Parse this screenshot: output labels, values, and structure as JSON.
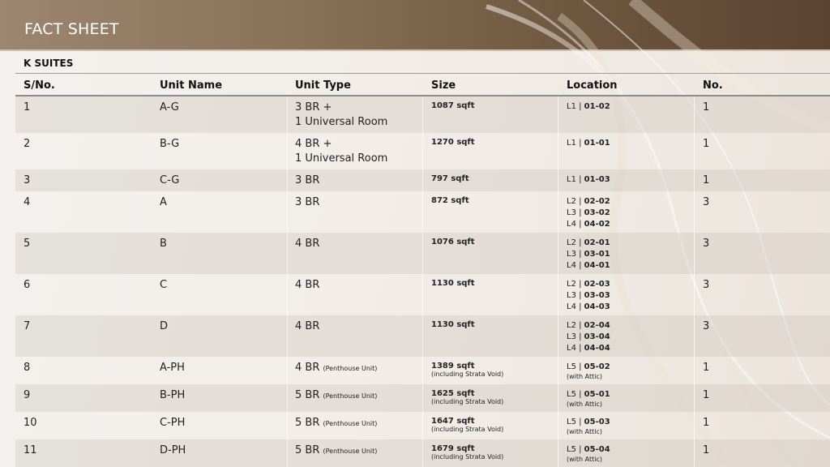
{
  "header": {
    "title": "FACT SHEET"
  },
  "section": {
    "title": "K SUITES"
  },
  "columns": [
    "S/No.",
    "Unit Name",
    "Unit Type",
    "Size",
    "Location",
    "No."
  ],
  "rows": [
    {
      "sno": "1",
      "name": "A-G",
      "type": "3 BR +",
      "type2": "1 Universal Room",
      "type_note": "",
      "size": "1087 sqft",
      "size_note": "",
      "loc": [
        [
          "L1",
          "01-02"
        ]
      ],
      "loc_note": "",
      "no": "1"
    },
    {
      "sno": "2",
      "name": "B-G",
      "type": "4 BR +",
      "type2": "1 Universal Room",
      "type_note": "",
      "size": "1270 sqft",
      "size_note": "",
      "loc": [
        [
          "L1",
          "01-01"
        ]
      ],
      "loc_note": "",
      "no": "1"
    },
    {
      "sno": "3",
      "name": "C-G",
      "type": "3 BR",
      "type2": "",
      "type_note": "",
      "size": "797 sqft",
      "size_note": "",
      "loc": [
        [
          "L1",
          "01-03"
        ]
      ],
      "loc_note": "",
      "no": "1"
    },
    {
      "sno": "4",
      "name": "A",
      "type": "3 BR",
      "type2": "",
      "type_note": "",
      "size": "872 sqft",
      "size_note": "",
      "loc": [
        [
          "L2",
          "02-02"
        ],
        [
          "L3",
          "03-02"
        ],
        [
          "L4",
          "04-02"
        ]
      ],
      "loc_note": "",
      "no": "3"
    },
    {
      "sno": "5",
      "name": "B",
      "type": "4 BR",
      "type2": "",
      "type_note": "",
      "size": "1076 sqft",
      "size_note": "",
      "loc": [
        [
          "L2",
          "02-01"
        ],
        [
          "L3",
          "03-01"
        ],
        [
          "L4",
          "04-01"
        ]
      ],
      "loc_note": "",
      "no": "3"
    },
    {
      "sno": "6",
      "name": "C",
      "type": "4 BR",
      "type2": "",
      "type_note": "",
      "size": "1130 sqft",
      "size_note": "",
      "loc": [
        [
          "L2",
          "02-03"
        ],
        [
          "L3",
          "03-03"
        ],
        [
          "L4",
          "04-03"
        ]
      ],
      "loc_note": "",
      "no": "3"
    },
    {
      "sno": "7",
      "name": "D",
      "type": "4 BR",
      "type2": "",
      "type_note": "",
      "size": "1130 sqft",
      "size_note": "",
      "loc": [
        [
          "L2",
          "02-04"
        ],
        [
          "L3",
          "03-04"
        ],
        [
          "L4",
          "04-04"
        ]
      ],
      "loc_note": "",
      "no": "3"
    },
    {
      "sno": "8",
      "name": "A-PH",
      "type": "4 BR",
      "type2": "",
      "type_note": "(Penthouse Unit)",
      "size": "1389 sqft",
      "size_note": "(including Strata Void)",
      "loc": [
        [
          "L5",
          "05-02"
        ]
      ],
      "loc_note": "(with Attic)",
      "no": "1"
    },
    {
      "sno": "9",
      "name": "B-PH",
      "type": "5 BR",
      "type2": "",
      "type_note": "(Penthouse Unit)",
      "size": "1625 sqft",
      "size_note": "(including Strata Void)",
      "loc": [
        [
          "L5",
          "05-01"
        ]
      ],
      "loc_note": "(with Attic)",
      "no": "1"
    },
    {
      "sno": "10",
      "name": "C-PH",
      "type": "5 BR",
      "type2": "",
      "type_note": "(Penthouse Unit)",
      "size": "1647 sqft",
      "size_note": "(including Strata Void)",
      "loc": [
        [
          "L5",
          "05-03"
        ]
      ],
      "loc_note": "(with Attic)",
      "no": "1"
    },
    {
      "sno": "11",
      "name": "D-PH",
      "type": "5 BR",
      "type2": "",
      "type_note": "(Penthouse Unit)",
      "size": "1679 sqft",
      "size_note": "(including Strata Void)",
      "loc": [
        [
          "L5",
          "05-04"
        ]
      ],
      "loc_note": "(with Attic)",
      "no": "1"
    }
  ]
}
